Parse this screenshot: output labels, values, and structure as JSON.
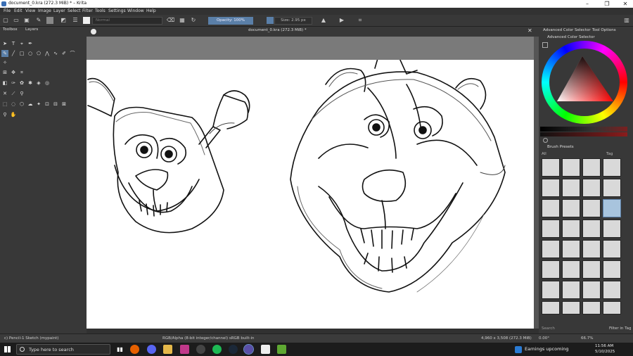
{
  "window": {
    "title": "document_0.kra (272.3 MiB) * – Krita"
  },
  "menu": [
    "File",
    "Edit",
    "View",
    "Image",
    "Layer",
    "Select",
    "Filter",
    "Tools",
    "Settings",
    "Window",
    "Help"
  ],
  "toolbar": {
    "blend_mode": "Normal",
    "opacity": "Opacity: 100%",
    "size": "Size: 2.95 px"
  },
  "left_dock": {
    "tabs": [
      "Toolbox",
      "Layers"
    ]
  },
  "document": {
    "tab_title": "document_0.kra (272.3 MiB) *"
  },
  "right_dock": {
    "top_tabs": [
      "Advanced Color Selector",
      "Tool Options"
    ],
    "color_selector_title": "Advanced Color Selector",
    "brush_presets_title": "Brush Presets",
    "filter_all": "All",
    "tag": "Tag",
    "search_placeholder": "Search",
    "filter_in_tag": "Filter in Tag",
    "rotation": "0.00°"
  },
  "status": {
    "brush": "c) Pencil-1 Sketch (mypaint)",
    "color_space": "RGB/Alpha (8-bit integer/channel)  sRGB built-in",
    "dimensions": "4,960 x 3,508 (272.3 MiB)",
    "zoom": "66.7%"
  },
  "taskbar": {
    "search_placeholder": "Type here to search",
    "news": "Earnings upcoming",
    "time": "11:56 AM",
    "date": "5/10/2025"
  }
}
